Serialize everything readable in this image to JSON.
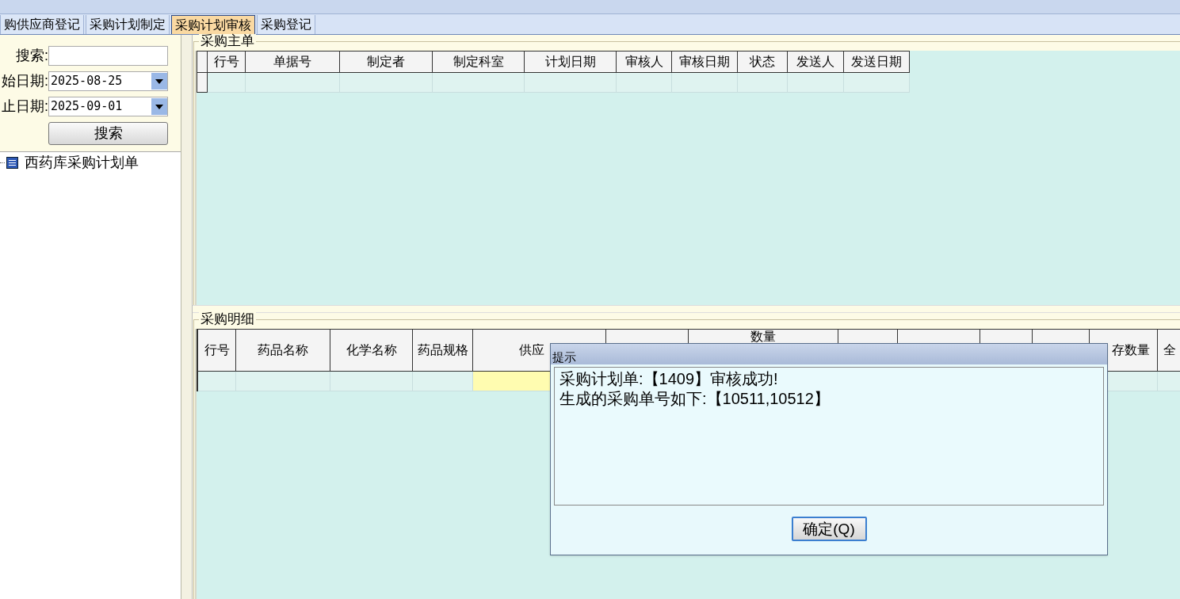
{
  "tabs": [
    {
      "label": "购供应商登记",
      "selected": false
    },
    {
      "label": "采购计划制定",
      "selected": false
    },
    {
      "label": "采购计划审核",
      "selected": true
    },
    {
      "label": "采购登记",
      "selected": false
    }
  ],
  "filters": [
    {
      "kind": "text",
      "label": "搜索:"
    },
    {
      "kind": "date",
      "label": "始日期:",
      "value": "2025-08-25"
    },
    {
      "kind": "date",
      "label": "止日期:",
      "value": "2025-09-01"
    }
  ],
  "search_button": "搜索",
  "tree": [
    {
      "label": "西药库采购计划单"
    }
  ],
  "master": {
    "title": "采购主单",
    "columns": [
      {
        "label": "行号"
      },
      {
        "label": "单据号"
      },
      {
        "label": "制定者"
      },
      {
        "label": "制定科室"
      },
      {
        "label": "计划日期"
      },
      {
        "label": "审核人"
      },
      {
        "label": "审核日期"
      },
      {
        "label": "状态"
      },
      {
        "label": "发送人"
      },
      {
        "label": "发送日期"
      }
    ],
    "row": {
      "cells": [
        {
          "selected": false
        },
        {
          "selected": false
        },
        {
          "selected": false
        },
        {
          "selected": false
        },
        {
          "selected": false
        },
        {
          "selected": false
        },
        {
          "selected": false
        },
        {
          "selected": false
        },
        {
          "selected": false
        },
        {
          "selected": false
        }
      ]
    }
  },
  "detail": {
    "title": "采购明细",
    "columns": [
      {
        "label": "行号"
      },
      {
        "label": "药品名称"
      },
      {
        "label": "化学名称"
      },
      {
        "label": "药品规格"
      },
      {
        "label": "供应"
      },
      {},
      {
        "label": "数量"
      },
      {},
      {},
      {},
      {},
      {
        "label": "存数量"
      },
      {
        "label": "全"
      }
    ],
    "row": {
      "cells": [
        {
          "selected": false
        },
        {
          "selected": false
        },
        {
          "selected": false
        },
        {
          "selected": false
        },
        {
          "selected": true
        },
        {},
        {},
        {},
        {},
        {},
        {},
        {
          "selected": false
        },
        {
          "selected": false
        }
      ]
    }
  },
  "dialog": {
    "title": "提示",
    "lines": [
      "采购计划单:【1409】审核成功!",
      "生成的采购单号如下:【10511,10512】"
    ],
    "button": "确定(Q)"
  }
}
